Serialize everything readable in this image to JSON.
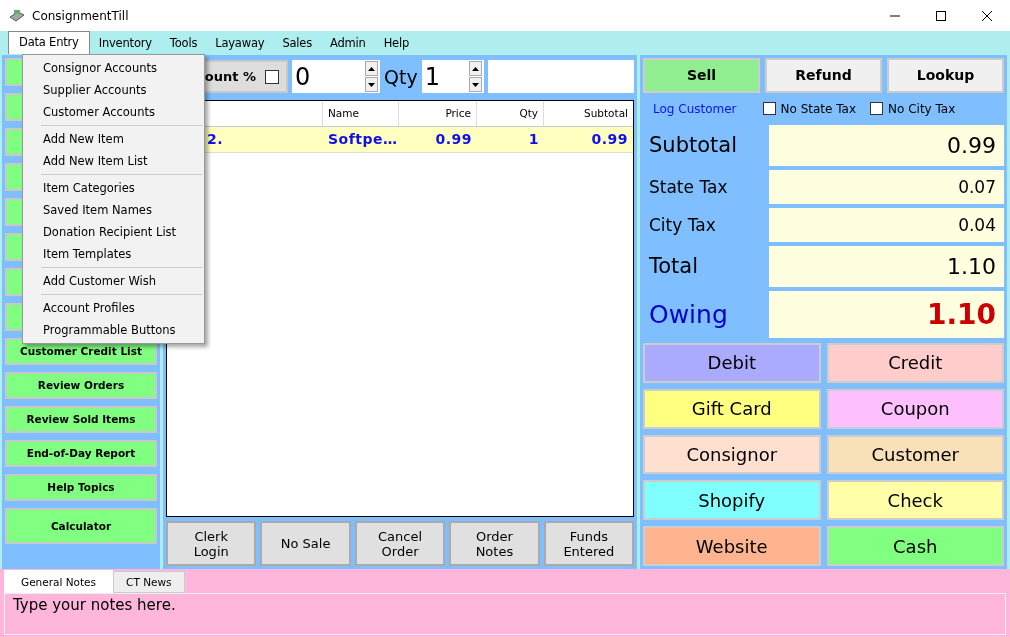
{
  "window": {
    "title": "ConsignmentTill"
  },
  "menu_bar": [
    {
      "label": "Data Entry",
      "selected": true
    },
    {
      "label": "Inventory",
      "selected": false
    },
    {
      "label": "Tools",
      "selected": false
    },
    {
      "label": "Layaway",
      "selected": false
    },
    {
      "label": "Sales",
      "selected": false
    },
    {
      "label": "Admin",
      "selected": false
    },
    {
      "label": "Help",
      "selected": false
    }
  ],
  "open_menu": {
    "groups": [
      [
        "Consignor Accounts",
        "Supplier Accounts",
        "Customer Accounts"
      ],
      [
        "Add New Item",
        "Add New Item List"
      ],
      [
        "Item Categories",
        "Saved Item Names",
        "Donation Recipient List",
        "Item Templates"
      ],
      [
        "Add Customer Wish"
      ],
      [
        "Account Profiles",
        "Programmable Buttons"
      ]
    ]
  },
  "left_buttons": [
    "Customer Credit List",
    "Review Orders",
    "Review Sold Items",
    "End-of-Day Report",
    "Help Topics",
    "Calculator"
  ],
  "entry_bar": {
    "discount": {
      "label": "ount %",
      "checked": false
    },
    "discount_value": "0",
    "qty_label": "Qty",
    "qty_value": "1"
  },
  "table": {
    "columns": [
      "",
      "Name",
      "Price",
      "Qty",
      "Subtotal"
    ],
    "rows": [
      {
        "cells": [
          "2.",
          "Softpe…",
          "0.99",
          "1",
          "0.99"
        ],
        "selected": true
      }
    ]
  },
  "order_buttons": [
    "Clerk Login",
    "No Sale",
    "Cancel Order",
    "Order Notes",
    "Funds Entered"
  ],
  "mode_buttons": [
    {
      "label": "Sell",
      "selected": true
    },
    {
      "label": "Refund",
      "selected": false
    },
    {
      "label": "Lookup",
      "selected": false
    }
  ],
  "log_customer": "Log Customer",
  "tax_options": [
    {
      "label": "No State Tax",
      "checked": false
    },
    {
      "label": "No City Tax",
      "checked": false
    }
  ],
  "totals": [
    {
      "kind": "large",
      "label": "Subtotal",
      "value": "0.99"
    },
    {
      "kind": "small",
      "label": "State Tax",
      "value": "0.07"
    },
    {
      "kind": "small",
      "label": "City Tax",
      "value": "0.04"
    },
    {
      "kind": "large",
      "label": "Total",
      "value": "1.10"
    },
    {
      "kind": "owing",
      "label": "Owing",
      "value": "1.10"
    }
  ],
  "payment_buttons": [
    {
      "label": "Debit",
      "color": "#aaaaff"
    },
    {
      "label": "Credit",
      "color": "#ffcccc"
    },
    {
      "label": "Gift Card",
      "color": "#ffff80"
    },
    {
      "label": "Coupon",
      "color": "#ffc0ff"
    },
    {
      "label": "Consignor",
      "color": "#ffe0d0"
    },
    {
      "label": "Customer",
      "color": "#f8e0b8"
    },
    {
      "label": "Shopify",
      "color": "#80ffff"
    },
    {
      "label": "Check",
      "color": "#ffffa8"
    },
    {
      "label": "Website",
      "color": "#ffb490"
    },
    {
      "label": "Cash",
      "color": "#80ff80"
    }
  ],
  "notes_tabs": [
    {
      "label": "General Notes",
      "selected": true
    },
    {
      "label": "CT News",
      "selected": false
    }
  ],
  "notes": {
    "value": "Type your notes here."
  }
}
